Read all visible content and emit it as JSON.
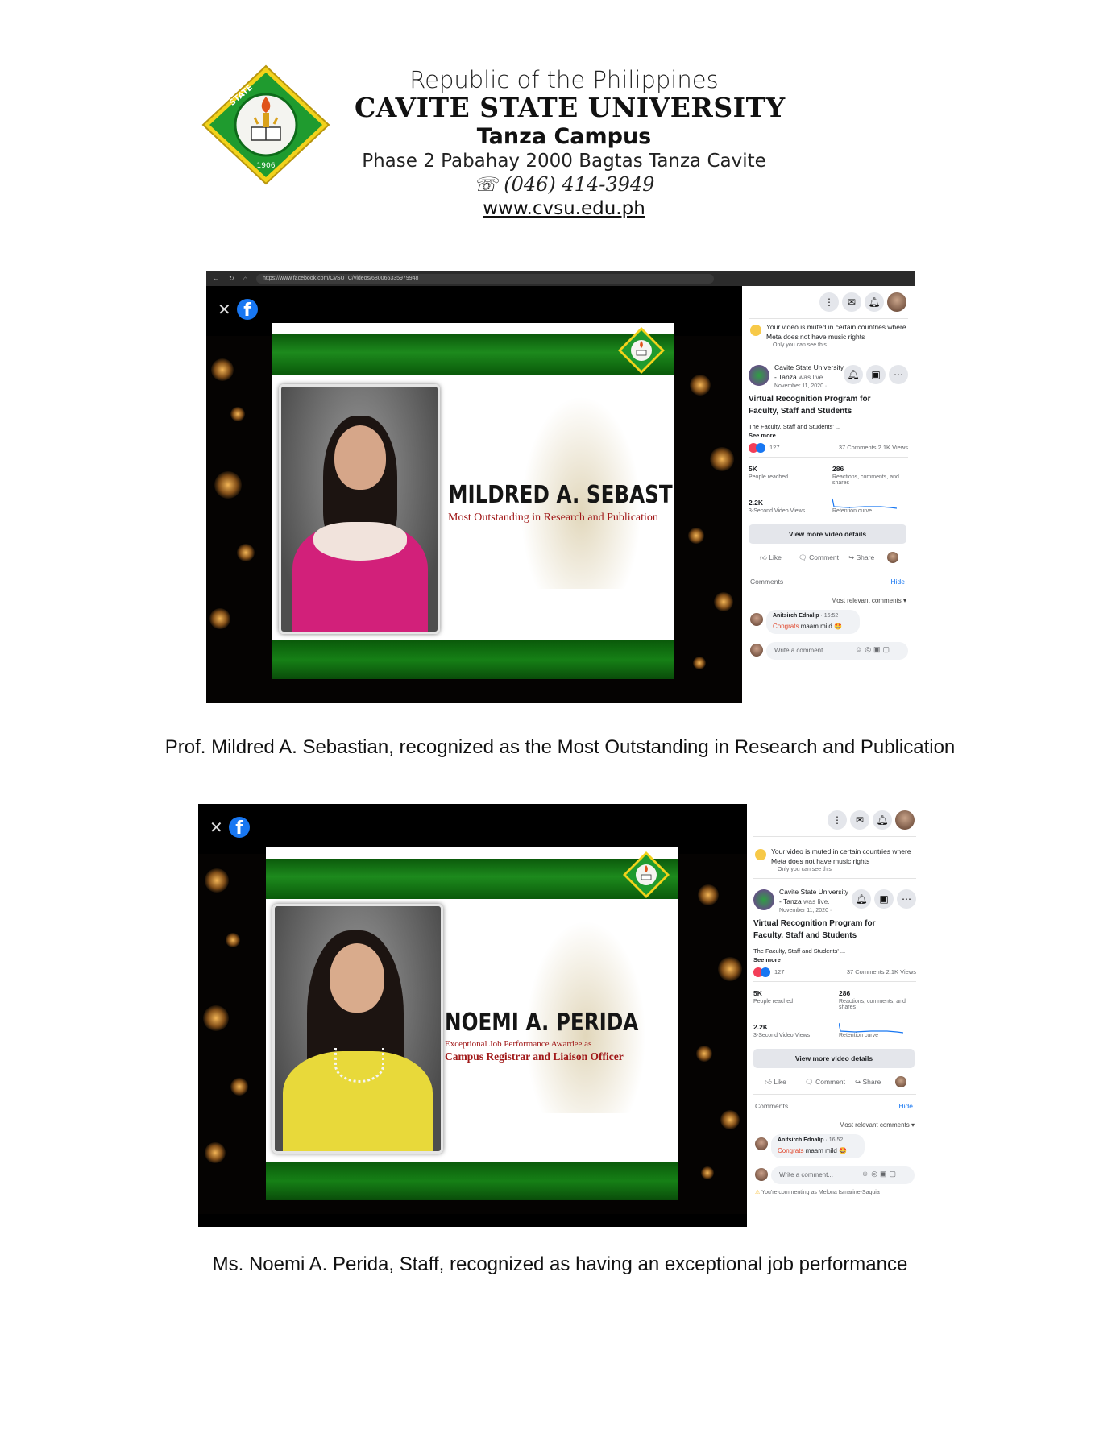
{
  "letterhead": {
    "republic": "Republic of the Philippines",
    "university": "CAVITE STATE UNIVERSITY",
    "campus": "Tanza Campus",
    "address": "Phase 2 Pabahay 2000 Bagtas Tanza Cavite",
    "phone": "☏ (046) 414-3949",
    "website": "www.cvsu.edu.ph",
    "seal": {
      "ring_text": "CAVITE STATE UNIVERSITY",
      "bottom_text": "CAVITE · 1906 · PHILIPPINES"
    }
  },
  "colors": {
    "seal_green": "#1f9b2f",
    "slide_green": "#117a11",
    "title_red": "#a01818",
    "fb_blue": "#1877f2"
  },
  "shots": [
    {
      "browser_url": "https://www.facebook.com/CvSUTC/videos/680066335979948",
      "slide": {
        "name": "MILDRED A. SEBASTIAN",
        "title_line1": "Most Outstanding in Research and Publication",
        "title_line2": ""
      },
      "panel": {
        "notice_line1": "Your video is muted in certain countries where",
        "notice_line2": "Meta does not have music rights",
        "notice_sub": "Only you can see this",
        "page_name_line1": "Cavite State University",
        "page_name_line2": "- Tanza",
        "was_live": "was live.",
        "date": "November 11, 2020 · ",
        "video_title_line1": "Virtual Recognition Program for",
        "video_title_line2": "Faculty, Staff and Students",
        "description": "The Faculty, Staff and Students' ...",
        "see_more": "See more",
        "reactions": "127",
        "comments_views": "37 Comments  2.1K Views",
        "stat1_value": "5K",
        "stat1_label": "People reached",
        "stat2_value": "286",
        "stat2_label": "Reactions, comments, and shares",
        "stat3_value": "2.2K",
        "stat3_label": "3-Second Video Views",
        "stat4_label": "Retention curve",
        "details_button": "View more video details",
        "like": "Like",
        "comment": "Comment",
        "share": "Share",
        "comments_label": "Comments",
        "hide": "Hide",
        "sort": "Most relevant comments ▾",
        "commenter": "Anitsirch Ednalip",
        "comment_time": "· 16:52",
        "comment_highlight": "Congrats",
        "comment_rest": " maam mild 🤩",
        "write_placeholder": "Write a comment...",
        "commenting_as": ""
      }
    },
    {
      "browser_url": "",
      "slide": {
        "name": "NOEMI A. PERIDA",
        "title_line1": "Exceptional Job Performance Awardee as",
        "title_line2": "Campus Registrar and Liaison Officer"
      },
      "panel": {
        "notice_line1": "Your video is muted in certain countries where",
        "notice_line2": "Meta does not have music rights",
        "notice_sub": "Only you can see this",
        "page_name_line1": "Cavite State University",
        "page_name_line2": "- Tanza",
        "was_live": "was live.",
        "date": "November 11, 2020 · ",
        "video_title_line1": "Virtual Recognition Program for",
        "video_title_line2": "Faculty, Staff and Students",
        "description": "The Faculty, Staff and Students' ...",
        "see_more": "See more",
        "reactions": "127",
        "comments_views": "37 Comments  2.1K Views",
        "stat1_value": "5K",
        "stat1_label": "People reached",
        "stat2_value": "286",
        "stat2_label": "Reactions, comments, and shares",
        "stat3_value": "2.2K",
        "stat3_label": "3-Second Video Views",
        "stat4_label": "Retention curve",
        "details_button": "View more video details",
        "like": "Like",
        "comment": "Comment",
        "share": "Share",
        "comments_label": "Comments",
        "hide": "Hide",
        "sort": "Most relevant comments ▾",
        "commenter": "Anitsirch Ednalip",
        "comment_time": "· 16:52",
        "comment_highlight": "Congrats",
        "comment_rest": " maam mild 🤩",
        "write_placeholder": "Write a comment...",
        "commenting_as": "You're commenting as Melona Ismarine-Saquia"
      }
    }
  ],
  "captions": [
    "Prof. Mildred A. Sebastian, recognized as the Most Outstanding in Research and Publication",
    "Ms. Noemi A. Perida, Staff, recognized as having an exceptional job performance"
  ]
}
